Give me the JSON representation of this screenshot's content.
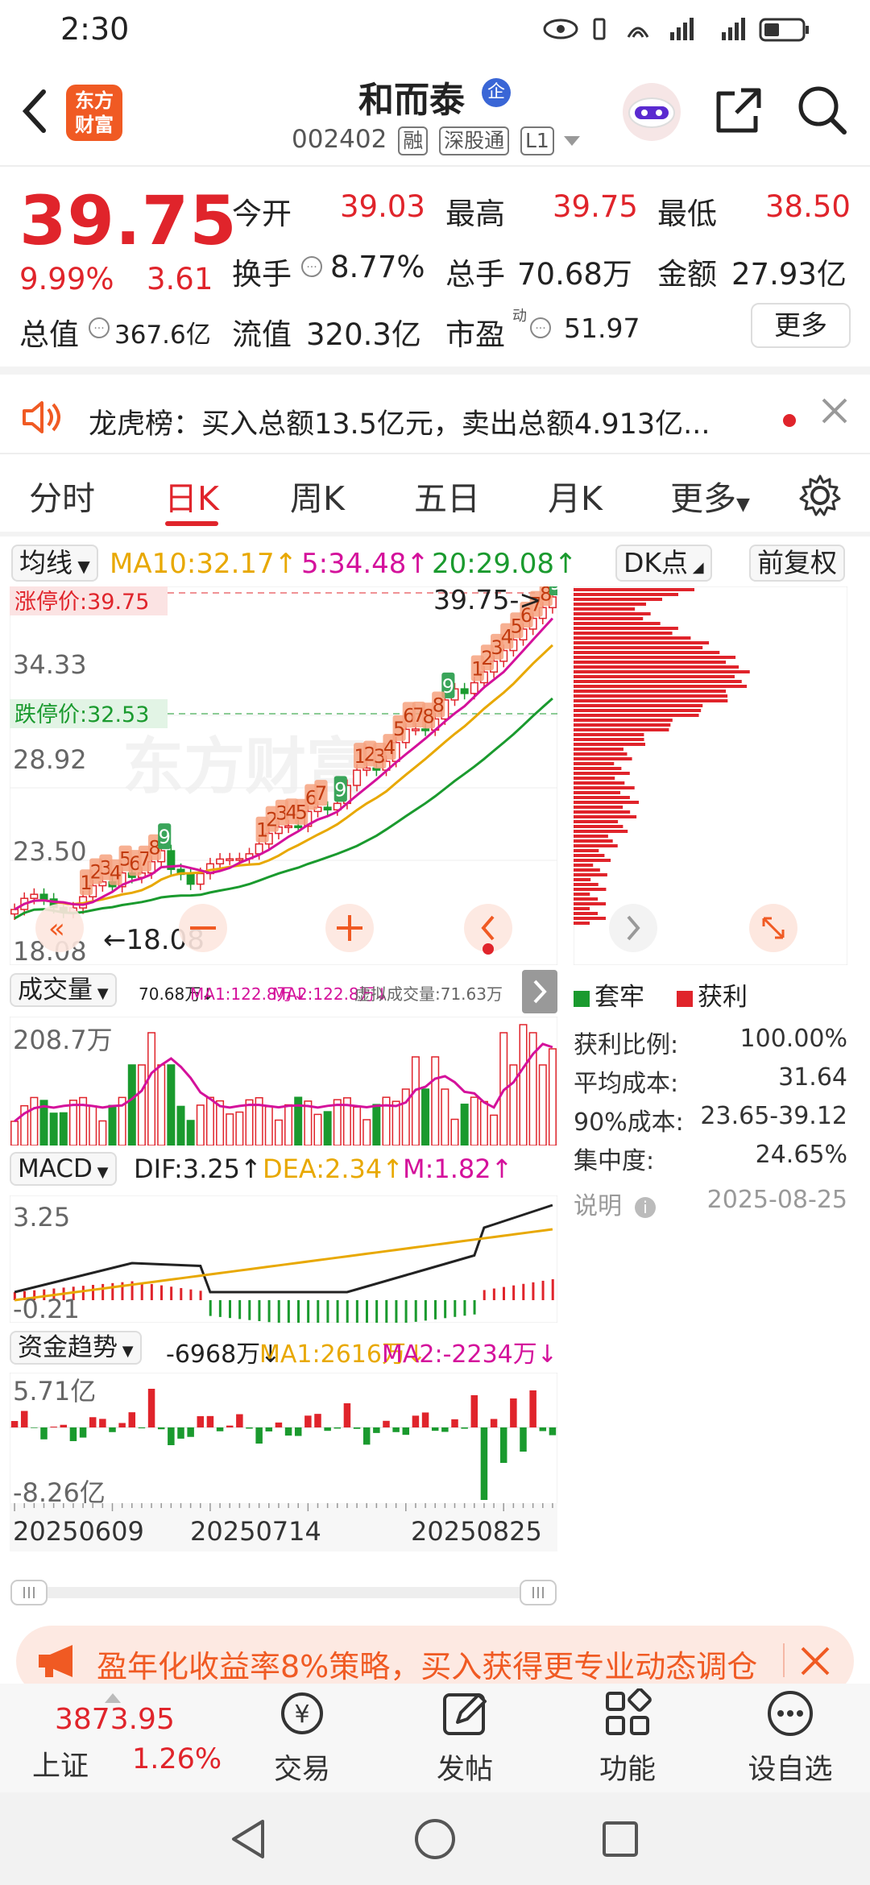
{
  "status_bar": {
    "time": "2:30"
  },
  "header": {
    "logo_text": "东方\n财富",
    "stock_name": "和而泰",
    "badge": "企",
    "stock_code": "002402",
    "tags": [
      "融",
      "深股通",
      "L1"
    ]
  },
  "quote": {
    "price": "39.75",
    "change_pct": "9.99%",
    "change_amt": "3.61",
    "open_label": "今开",
    "open": "39.03",
    "high_label": "最高",
    "high": "39.75",
    "low_label": "最低",
    "low": "38.50",
    "turnover_label": "换手",
    "turnover": "8.77%",
    "volume_label": "总手",
    "volume": "70.68万",
    "amount_label": "金额",
    "amount": "27.93亿",
    "mktcap_label": "总值",
    "mktcap": "367.6亿",
    "float_label": "流值",
    "float_cap": "320.3亿",
    "pe_label": "市盈",
    "pe_sup": "动",
    "pe": "51.97",
    "more_button": "更多"
  },
  "notice": {
    "text": "龙虎榜：买入总额13.5亿元，卖出总额4.913亿..."
  },
  "tabs": [
    "分时",
    "日K",
    "周K",
    "五日",
    "月K",
    "更多"
  ],
  "active_tab": "日K",
  "ma_bar": {
    "selector": "均线",
    "ma10": "MA10:32.17↑",
    "ma5": "5:34.48↑",
    "ma20": "20:29.08↑",
    "dk_button": "DK点",
    "adjust_button": "前复权"
  },
  "kline": {
    "limit_up_label": "涨停价:39.75",
    "limit_down_label": "跌停价:32.53",
    "price_arrow_label": "39.75->",
    "y_labels": [
      "34.33",
      "28.92",
      "23.50",
      "18.08"
    ],
    "low_marker": "18.08",
    "watermark": "东方财富",
    "tdx_marks": [
      "1",
      "2",
      "3",
      "4",
      "5",
      "6",
      "7",
      "8",
      "9",
      "1",
      "2",
      "3",
      "4",
      "5",
      "6",
      "7",
      "9",
      "1",
      "2",
      "3",
      "4",
      "5",
      "6",
      "7",
      "8",
      "9",
      "1",
      "2",
      "3",
      "4",
      "8",
      "5",
      "6",
      "7",
      "8",
      "9"
    ]
  },
  "volume_panel": {
    "selector": "成交量",
    "values_line": "70.68万↓",
    "ma1": "MA1:122.8万↓",
    "ma2": "MA2:122.8万↓",
    "virtual": "虚拟成交量:71.63万",
    "top_label": "208.7万"
  },
  "macd_panel": {
    "selector": "MACD",
    "dif": "DIF:3.25↑",
    "dea": "DEA:2.34↑",
    "m": "M:1.82↑",
    "top_label": "3.25",
    "bottom_label": "-0.21"
  },
  "fund_panel": {
    "selector": "资金趋势",
    "value": "-6968万↓",
    "ma1": "MA1:2616万↓",
    "ma2": "MA2:-2234万↓",
    "top_label": "5.71亿",
    "bottom_label": "-8.26亿"
  },
  "x_dates": [
    "20250609",
    "20250714",
    "20250825"
  ],
  "cyq": {
    "legend_trapped": "套牢",
    "legend_profit": "获利",
    "stats": [
      {
        "label": "获利比例:",
        "value": "100.00%"
      },
      {
        "label": "平均成本:",
        "value": "31.64"
      },
      {
        "label": "90%成本:",
        "value": "23.65-39.12"
      },
      {
        "label": "集中度:",
        "value": "24.65%"
      }
    ],
    "note_label": "说明",
    "date": "2025-08-25"
  },
  "banner": {
    "text": "盈年化收益率8%策略，买入获得更专业动态调仓"
  },
  "bottom_nav": {
    "index_value": "3873.95",
    "index_name": "上证",
    "index_change": "1.26%",
    "items": [
      "交易",
      "发帖",
      "功能",
      "设自选"
    ]
  },
  "colors": {
    "up": "#e0242b",
    "down": "#1a9a2e",
    "ma5": "#d4119b",
    "ma10": "#e8a800",
    "ma20": "#1a9a2e",
    "accent": "#f05a23"
  }
}
